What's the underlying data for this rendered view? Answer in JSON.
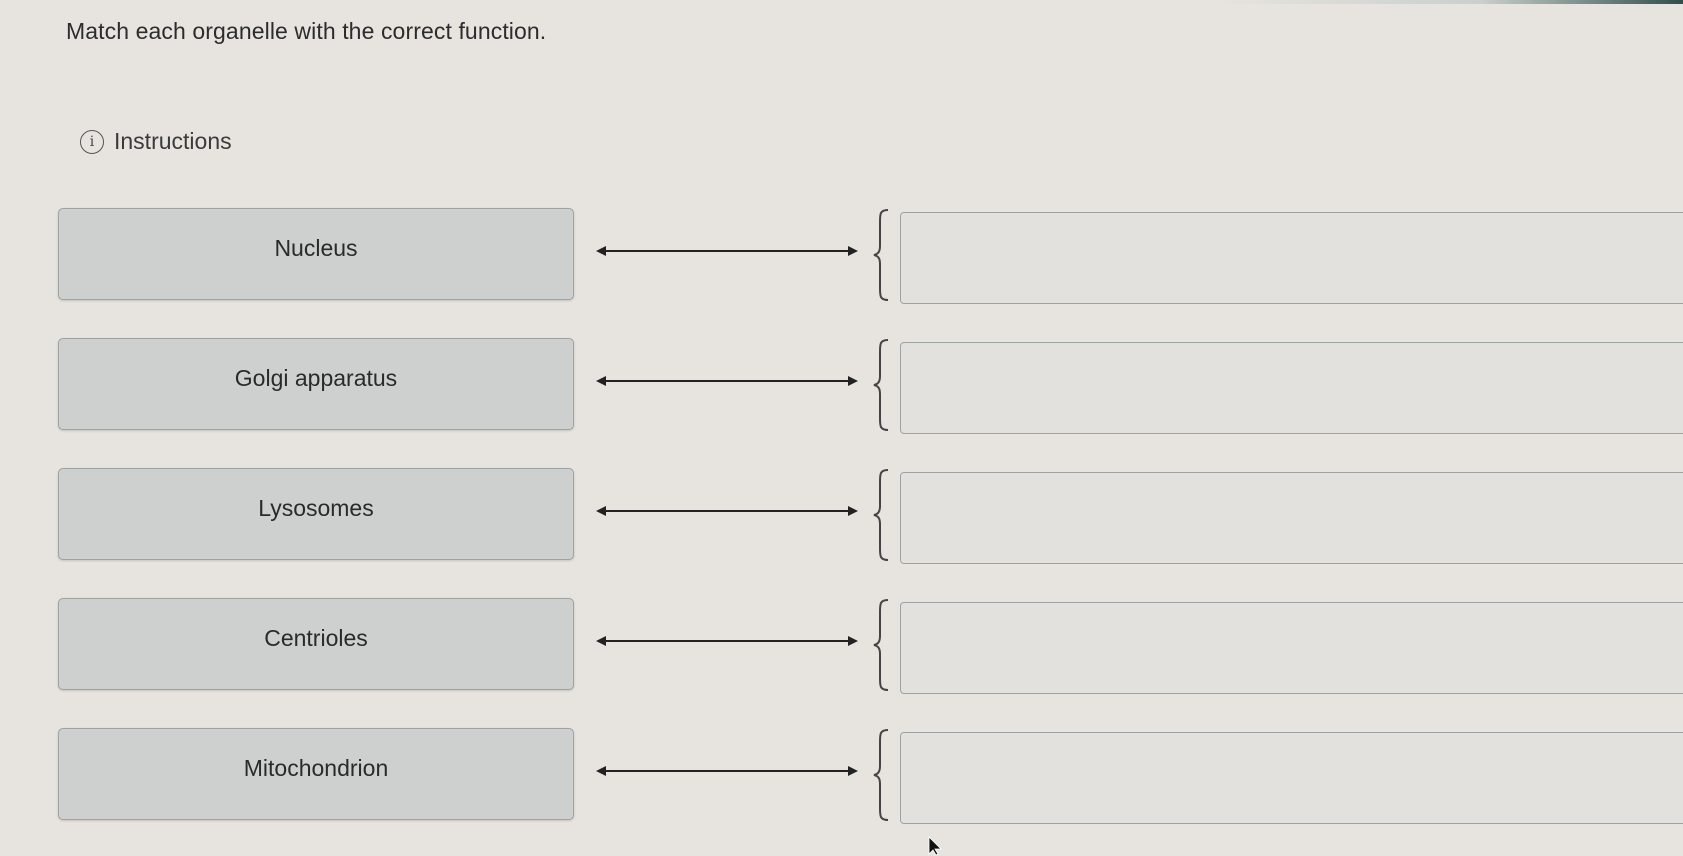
{
  "question": {
    "text": "Match each organelle with the correct function."
  },
  "instructions": {
    "label": "Instructions",
    "icon": "info-icon",
    "icon_glyph": "i"
  },
  "matches": [
    {
      "term": "Nucleus",
      "answer": ""
    },
    {
      "term": "Golgi apparatus",
      "answer": ""
    },
    {
      "term": "Lysosomes",
      "answer": ""
    },
    {
      "term": "Centrioles",
      "answer": ""
    },
    {
      "term": "Mitochondrion",
      "answer": ""
    }
  ],
  "colors": {
    "background": "#e7e4df",
    "term_fill": "#cdd0ce",
    "border": "#9ea3a2",
    "connector": "#222222"
  }
}
